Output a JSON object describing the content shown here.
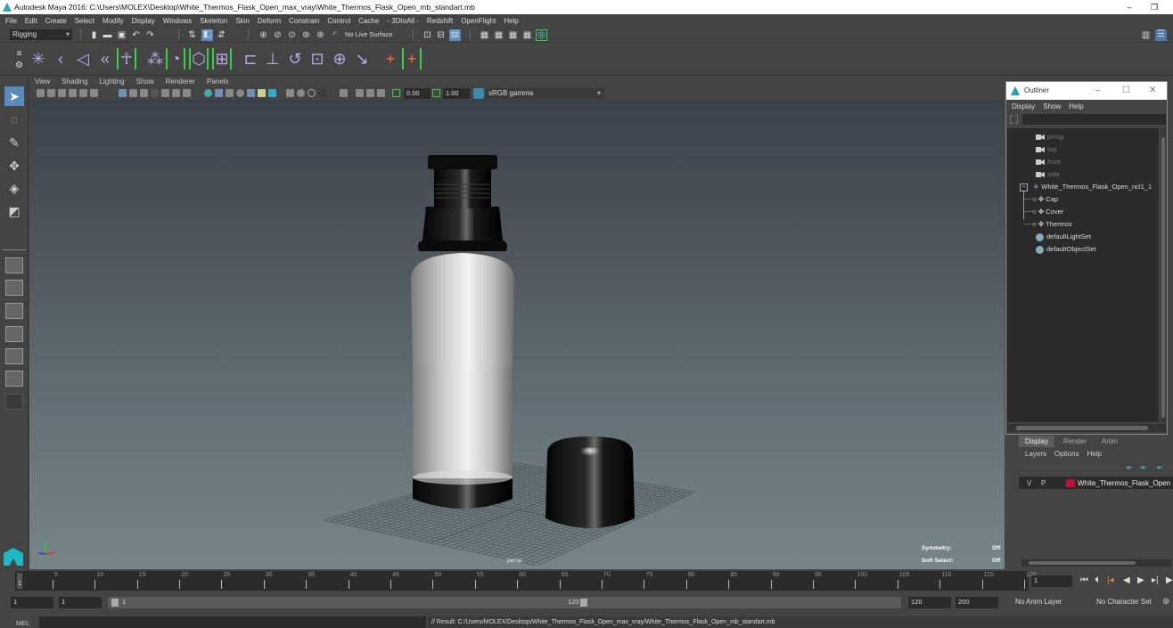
{
  "window": {
    "title": "Autodesk Maya 2016: C:\\Users\\MOLEX\\Desktop\\White_Thermos_Flask_Open_max_vray\\White_Thermos_Flask_Open_mb_standart.mb",
    "minimize": "–",
    "restore": "❐"
  },
  "menubar": [
    "File",
    "Edit",
    "Create",
    "Select",
    "Modify",
    "Display",
    "Windows",
    "Skeleton",
    "Skin",
    "Deform",
    "Constrain",
    "Control",
    "Cache",
    "- 3DtoAll -",
    "Redshift",
    "OpenFlight",
    "Help"
  ],
  "shelf": {
    "mode": "Rigging",
    "live_surface": "No Live Surface"
  },
  "viewport": {
    "menu": [
      "View",
      "Shading",
      "Lighting",
      "Show",
      "Renderer",
      "Panels"
    ],
    "exposure": "0.00",
    "gamma": "1.00",
    "color_space": "sRGB gamma",
    "camera_label": "persp",
    "hud": [
      {
        "label": "Symmetry:",
        "value": "Off"
      },
      {
        "label": "Soft Select:",
        "value": "Off"
      }
    ]
  },
  "outliner": {
    "title": "Outliner",
    "menu": [
      "Display",
      "Show",
      "Help"
    ],
    "items": [
      {
        "label": "persp",
        "type": "camera"
      },
      {
        "label": "top",
        "type": "camera"
      },
      {
        "label": "front",
        "type": "camera"
      },
      {
        "label": "side",
        "type": "camera"
      },
      {
        "label": "White_Thermos_Flask_Open_ncl1_1",
        "type": "group"
      },
      {
        "label": "Cap",
        "type": "mesh"
      },
      {
        "label": "Cover",
        "type": "mesh"
      },
      {
        "label": "Thermos",
        "type": "mesh"
      },
      {
        "label": "defaultLightSet",
        "type": "set"
      },
      {
        "label": "defaultObjectSet",
        "type": "set"
      }
    ]
  },
  "layers": {
    "tabs": [
      "Display",
      "Render",
      "Anim"
    ],
    "menu": [
      "Layers",
      "Options",
      "Help"
    ],
    "rows": [
      {
        "v": "V",
        "p": "P",
        "name": "White_Thermos_Flask_Open",
        "color": "#c0103a"
      }
    ]
  },
  "timeline": {
    "ticks": [
      "5",
      "10",
      "15",
      "20",
      "25",
      "30",
      "35",
      "40",
      "45",
      "50",
      "55",
      "60",
      "65",
      "70",
      "75",
      "80",
      "85",
      "90",
      "95",
      "100",
      "105",
      "110",
      "115",
      "120"
    ],
    "current_marker": "1",
    "current_frame": "1"
  },
  "range": {
    "start": "1",
    "anim_start": "1",
    "slider_start": "1",
    "slider_end": "120",
    "end": "120",
    "anim_end": "200",
    "anim_layer": "No Anim Layer",
    "character_set": "No Character Set"
  },
  "cmdline": {
    "label": "MEL",
    "result": "// Result: C:/Users/MOLEX/Desktop/White_Thermos_Flask_Open_max_vray/White_Thermos_Flask_Open_mb_standart.mb"
  }
}
